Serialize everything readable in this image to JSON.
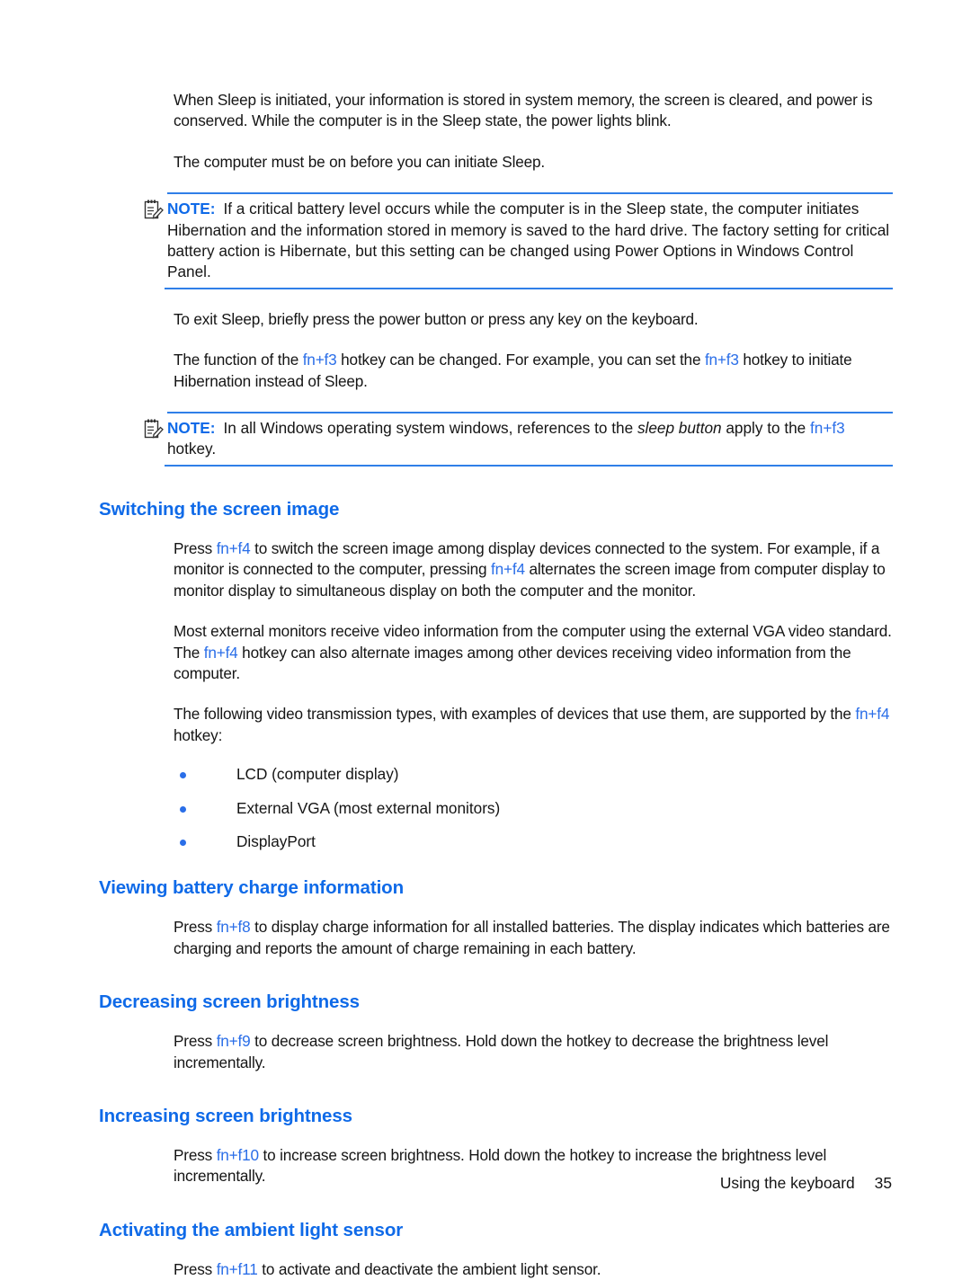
{
  "page": {
    "footer_label": "Using the keyboard",
    "footer_page_number": "35",
    "accent_blue": "#0f6ae8",
    "hotkey_blue": "#2a6ee8",
    "rule_blue": "#2f7fe8",
    "body_color": "#151515"
  },
  "intro": {
    "para1": "When Sleep is initiated, your information is stored in system memory, the screen is cleared, and power is conserved. While the computer is in the Sleep state, the power lights blink.",
    "para2": "The computer must be on before you can initiate Sleep."
  },
  "note1": {
    "label": "NOTE:",
    "icon": "note-clipboard-pencil-icon",
    "text": "If a critical battery level occurs while the computer is in the Sleep state, the computer initiates Hibernation and the information stored in memory is saved to the hard drive. The factory setting for critical battery action is Hibernate, but this setting can be changed using Power Options in Windows Control Panel."
  },
  "sleep_exit": {
    "para1": "To exit Sleep, briefly press the power button or press any key on the keyboard.",
    "para2_a": "The function of the ",
    "para2_hk1": "fn+f3",
    "para2_b": " hotkey can be changed. For example, you can set the ",
    "para2_hk2": "fn+f3",
    "para2_c": " hotkey to initiate Hibernation instead of Sleep."
  },
  "note2": {
    "label": "NOTE:",
    "icon": "note-clipboard-pencil-icon",
    "text_a": "In all Windows operating system windows, references to the ",
    "text_italic": "sleep button",
    "text_b": " apply to the ",
    "text_hk": "fn+f3",
    "text_c": " hotkey."
  },
  "sections": [
    {
      "heading": "Switching the screen image",
      "para1_a": "Press ",
      "para1_hk1": "fn+f4",
      "para1_b": " to switch the screen image among display devices connected to the system. For example, if a monitor is connected to the computer, pressing ",
      "para1_hk2": "fn+f4",
      "para1_c": " alternates the screen image from computer display to monitor display to simultaneous display on both the computer and the monitor.",
      "para2_a": "Most external monitors receive video information from the computer using the external VGA video standard. The ",
      "para2_hk1": "fn+f4",
      "para2_b": " hotkey can also alternate images among other devices receiving video information from the computer.",
      "para3_a": "The following video transmission types, with examples of devices that use them, are supported by the ",
      "para3_hk1": "fn+f4",
      "para3_b": " hotkey:",
      "bullets": [
        "LCD (computer display)",
        "External VGA (most external monitors)",
        "DisplayPort"
      ]
    },
    {
      "heading": "Viewing battery charge information",
      "para1_a": "Press ",
      "para1_hk1": "fn+f8",
      "para1_b": " to display charge information for all installed batteries. The display indicates which batteries are charging and reports the amount of charge remaining in each battery."
    },
    {
      "heading": "Decreasing screen brightness",
      "para1_a": "Press ",
      "para1_hk1": "fn+f9",
      "para1_b": " to decrease screen brightness. Hold down the hotkey to decrease the brightness level incrementally."
    },
    {
      "heading": "Increasing screen brightness",
      "para1_a": "Press ",
      "para1_hk1": "fn+f10",
      "para1_b": " to increase screen brightness. Hold down the hotkey to increase the brightness level incrementally."
    },
    {
      "heading": "Activating the ambient light sensor",
      "para1_a": "Press ",
      "para1_hk1": "fn+f11",
      "para1_b": " to activate and deactivate the ambient light sensor."
    }
  ]
}
